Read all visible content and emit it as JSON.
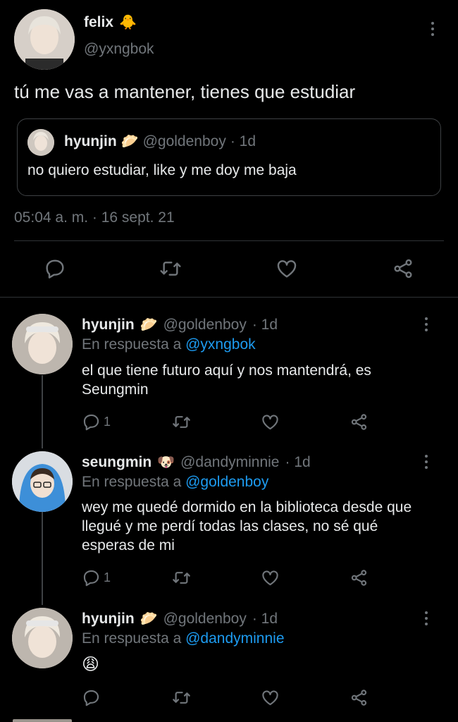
{
  "main_tweet": {
    "author_name": "felix",
    "author_emoji": "🐥",
    "handle": "@yxngbok",
    "text": "tú me vas a mantener, tienes que estudiar",
    "quote": {
      "author_name": "hyunjin",
      "author_emoji": "🥟",
      "handle": "@goldenboy",
      "time": "· 1d",
      "text": "no quiero estudiar, like y me doy me baja"
    },
    "timestamp": "05:04 a. m. · 16 sept. 21"
  },
  "replies": [
    {
      "author_name": "hyunjin",
      "author_emoji": "🥟",
      "handle": "@goldenboy",
      "time": "· 1d",
      "reply_prefix": "En respuesta a",
      "reply_to": "@yxngbok",
      "text": "el que tiene futuro aquí y nos mantendrá, es Seungmin",
      "reply_count": "1"
    },
    {
      "author_name": "seungmin",
      "author_emoji": "🐶",
      "handle": "@dandyminnie",
      "time": "· 1d",
      "reply_prefix": "En respuesta a",
      "reply_to": "@goldenboy",
      "text": "wey me quedé dormido en la biblioteca desde que llegué y me perdí todas las clases, no sé qué esperas de mi",
      "reply_count": "1"
    },
    {
      "author_name": "hyunjin",
      "author_emoji": "🥟",
      "handle": "@goldenboy",
      "time": "· 1d",
      "reply_prefix": "En respuesta a",
      "reply_to": "@dandyminnie",
      "text": "😩",
      "reply_count": ""
    }
  ],
  "colors": {
    "background": "#000000",
    "text": "#e7e9ea",
    "muted": "#71767b",
    "link": "#1d9bf0",
    "divider": "#2f3336"
  },
  "icons": [
    "reply-icon",
    "retweet-icon",
    "like-icon",
    "share-icon",
    "more-icon"
  ]
}
